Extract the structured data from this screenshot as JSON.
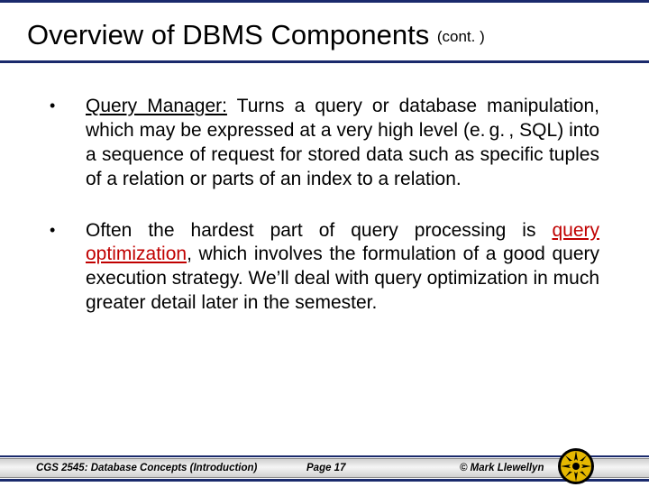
{
  "title": {
    "main": "Overview of DBMS Components",
    "cont": "(cont. )"
  },
  "bullets": [
    {
      "dot": "•",
      "term": "Query Manager:",
      "body_after_term": " Turns a query or database manipulation, which may be expressed at a very high level (e. g. , SQL) into a sequence of request for stored data such as specific tuples of a relation or parts of an index to a relation."
    },
    {
      "dot": "•",
      "pre": "Often the hardest part of query processing is ",
      "red_term": "query optimization",
      "post": ", which involves the formulation of a good query execution strategy.  We’ll deal with query optimization in much greater detail later in the semester."
    }
  ],
  "footer": {
    "course": "CGS 2545: Database Concepts  (Introduction)",
    "page": "Page 17",
    "copyright": "© Mark Llewellyn"
  }
}
